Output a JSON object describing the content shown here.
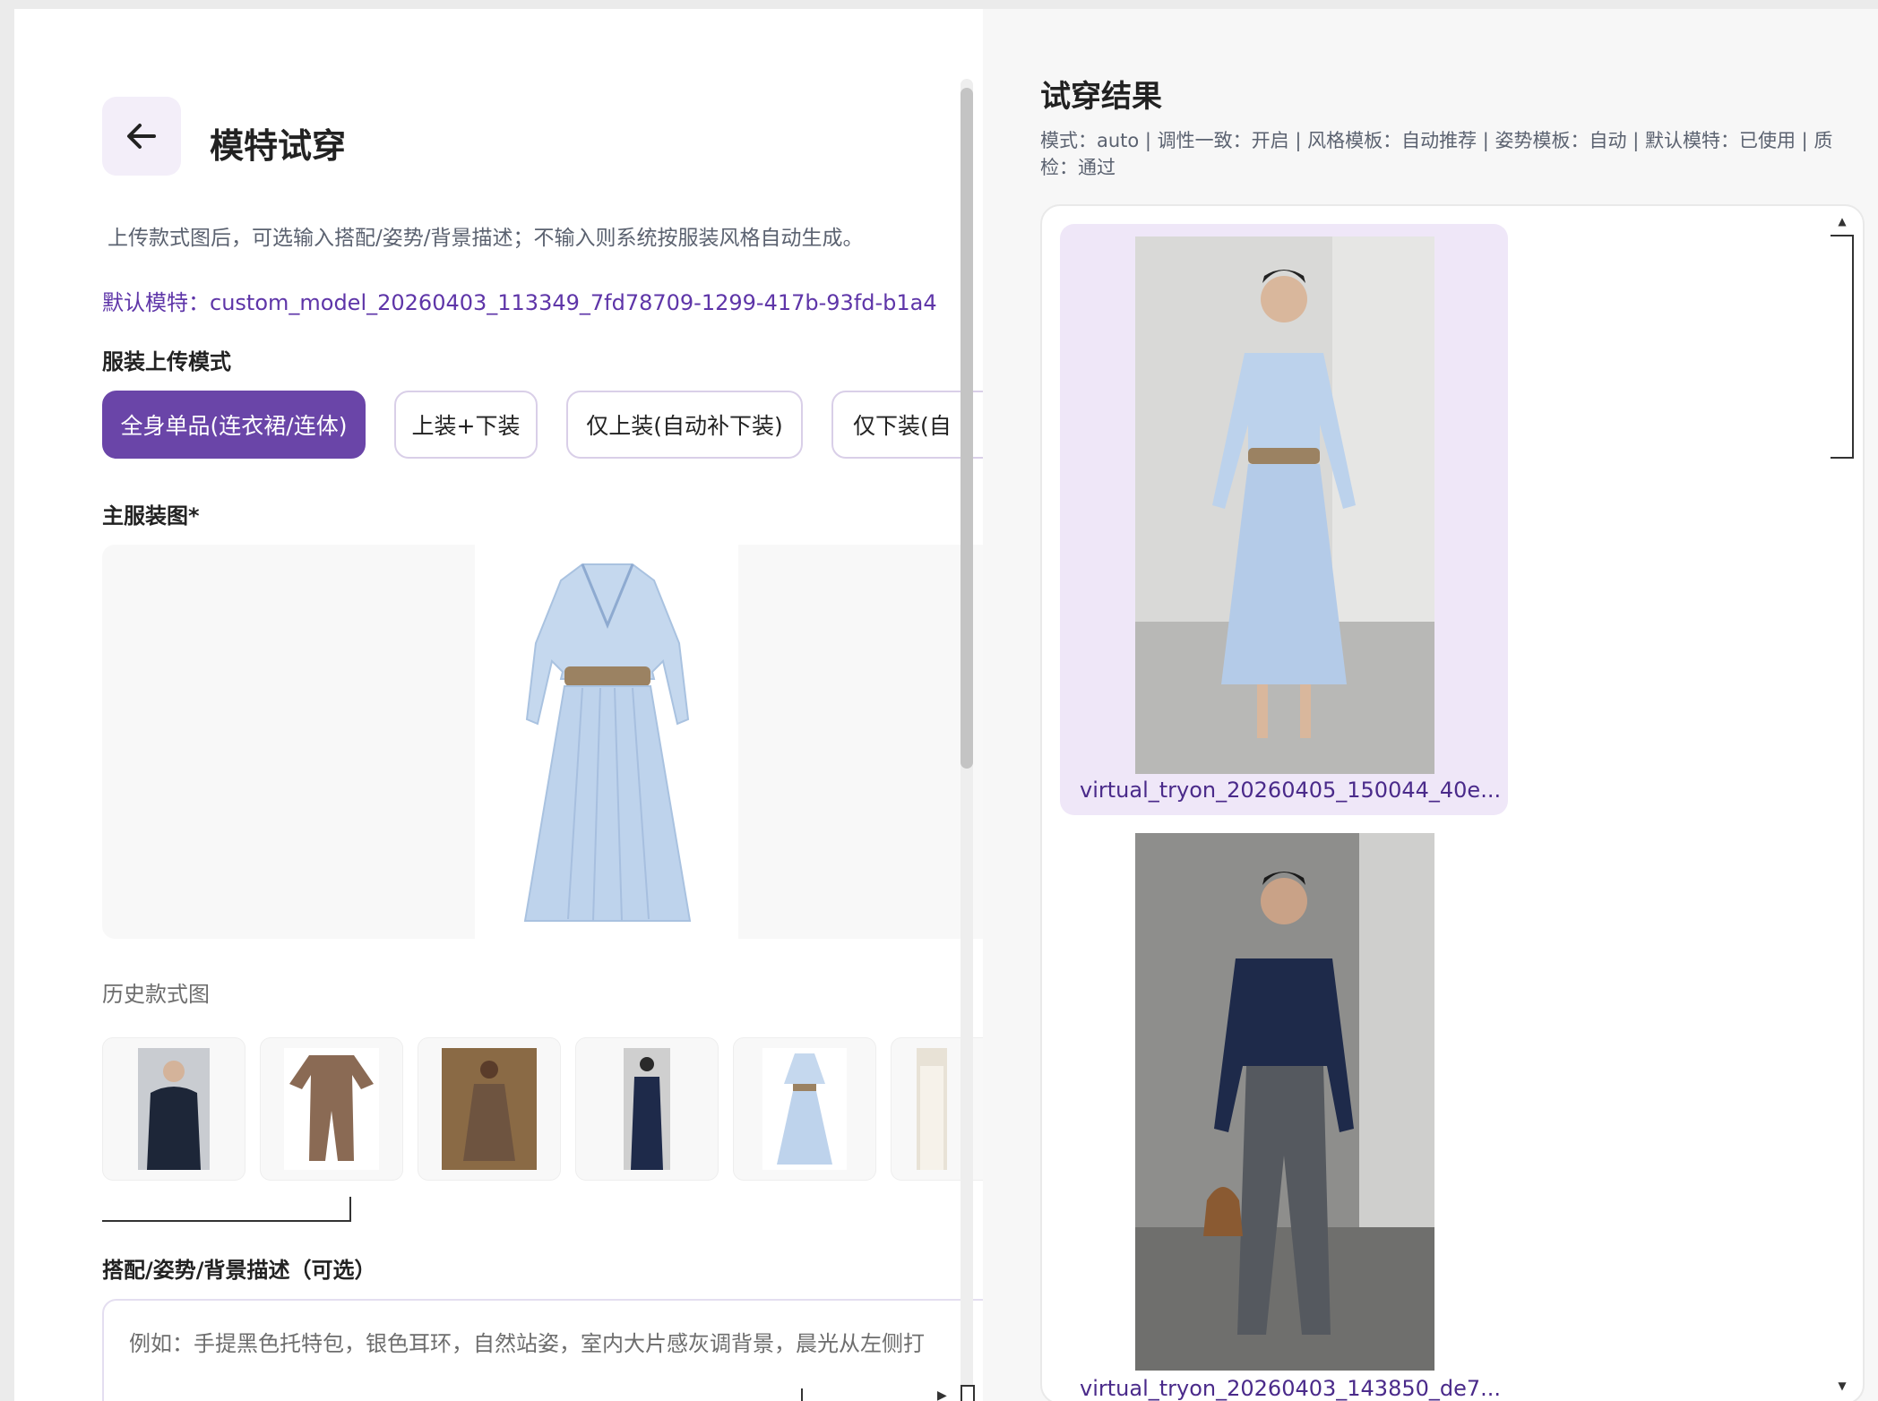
{
  "left": {
    "title": "模特试穿",
    "description": "上传款式图后，可选输入搭配/姿势/背景描述；不输入则系统按服装风格自动生成。",
    "default_model": "默认模特：custom_model_20260403_113349_7fd78709-1299-417b-93fd-b1a4",
    "upload_mode_label": "服装上传模式",
    "modes": [
      {
        "label": "全身单品(连衣裙/连体)",
        "active": true
      },
      {
        "label": "上装+下装",
        "active": false
      },
      {
        "label": "仅上装(自动补下装)",
        "active": false
      },
      {
        "label": "仅下装(自",
        "active": false
      }
    ],
    "main_image_label": "主服装图*",
    "history_label": "历史款式图",
    "history_items": [
      "suit-man",
      "brown-jumpsuit",
      "brown-dress-woman",
      "navy-suit-woman",
      "blue-dress",
      "white-outfit"
    ],
    "desc_label": "搭配/姿势/背景描述（可选）",
    "desc_placeholder": "例如：手提黑色托特包，银色耳环，自然站姿，室内大片感灰调背景，晨光从左侧打"
  },
  "right": {
    "title": "试穿结果",
    "meta": "模式：auto | 调性一致：开启 | 风格模板：自动推荐 | 姿势模板：自动 | 默认模特：已使用 | 质检：通过",
    "results": [
      {
        "caption": "virtual_tryon_20260405_150044_40e...",
        "selected": true
      },
      {
        "caption": "virtual_tryon_20260403_143850_de7...",
        "selected": false
      }
    ]
  },
  "colors": {
    "accent": "#6a45a8",
    "accent_light": "#efe7f8",
    "dress_blue": "#b8cfe9",
    "navy": "#1e2a4a"
  }
}
